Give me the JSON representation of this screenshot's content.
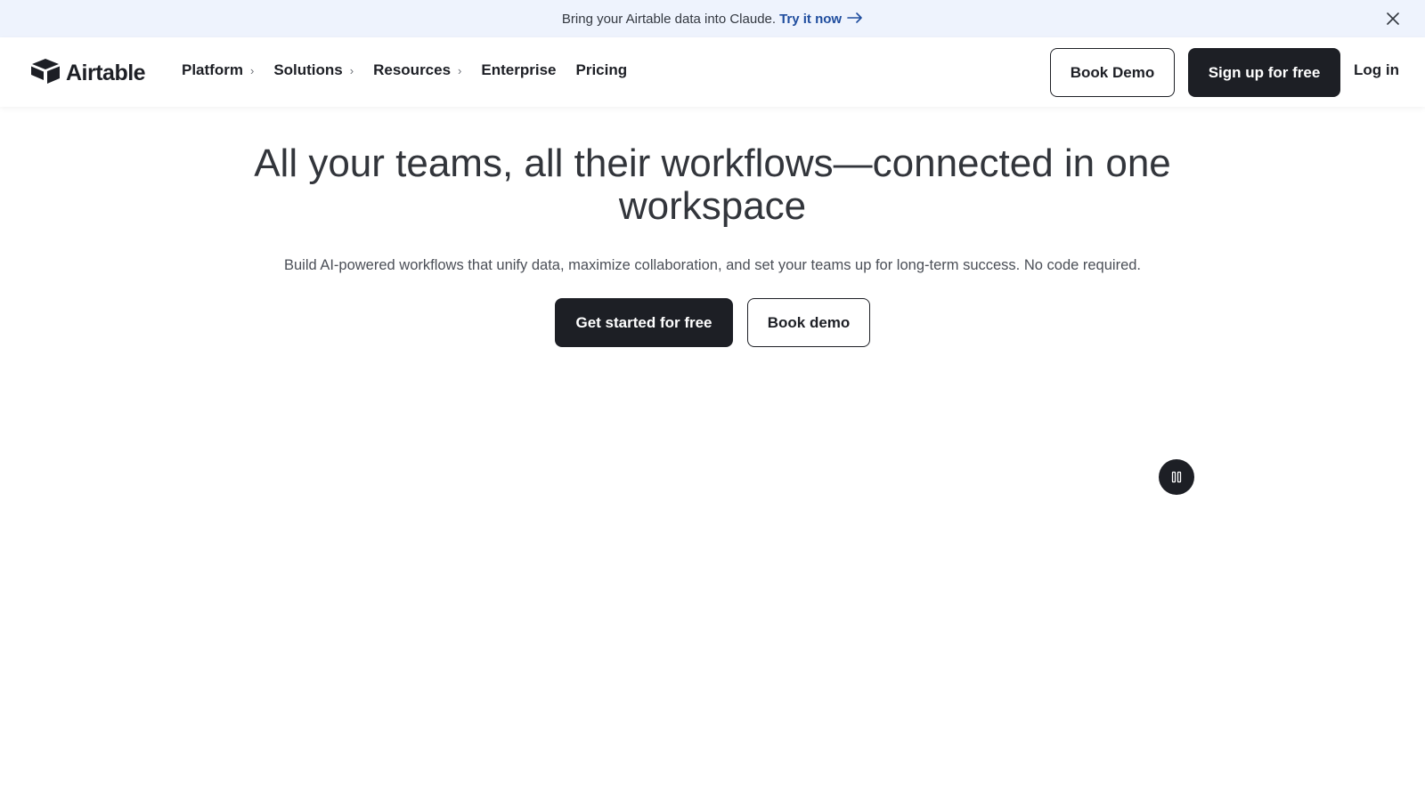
{
  "banner": {
    "text": "Bring your Airtable data into Claude.",
    "link_label": "Try it now",
    "arrow_icon": "arrow-right-icon",
    "close_icon": "close-icon",
    "background": "#eef3fd",
    "link_color": "#1f4d9e"
  },
  "nav": {
    "logo_text": "Airtable",
    "logo_icon": "airtable-logo-icon",
    "menu": [
      {
        "label": "Platform",
        "has_chevron": true
      },
      {
        "label": "Solutions",
        "has_chevron": true
      },
      {
        "label": "Resources",
        "has_chevron": true
      },
      {
        "label": "Enterprise",
        "has_chevron": false
      },
      {
        "label": "Pricing",
        "has_chevron": false
      }
    ],
    "chevron_glyph": "›",
    "book_demo": "Book Demo",
    "signup": "Sign up for free",
    "login": "Log in"
  },
  "hero": {
    "title": "All your teams, all their workflows—connected in one workspace",
    "subtitle": "Build AI-powered workflows that unify data, maximize collaboration, and set your teams up for long-term success. No code required.",
    "primary_cta": "Get started for free",
    "secondary_cta": "Book demo"
  },
  "media": {
    "pause_icon": "pause-icon"
  },
  "colors": {
    "dark": "#1d1f25",
    "text": "#32353b"
  }
}
